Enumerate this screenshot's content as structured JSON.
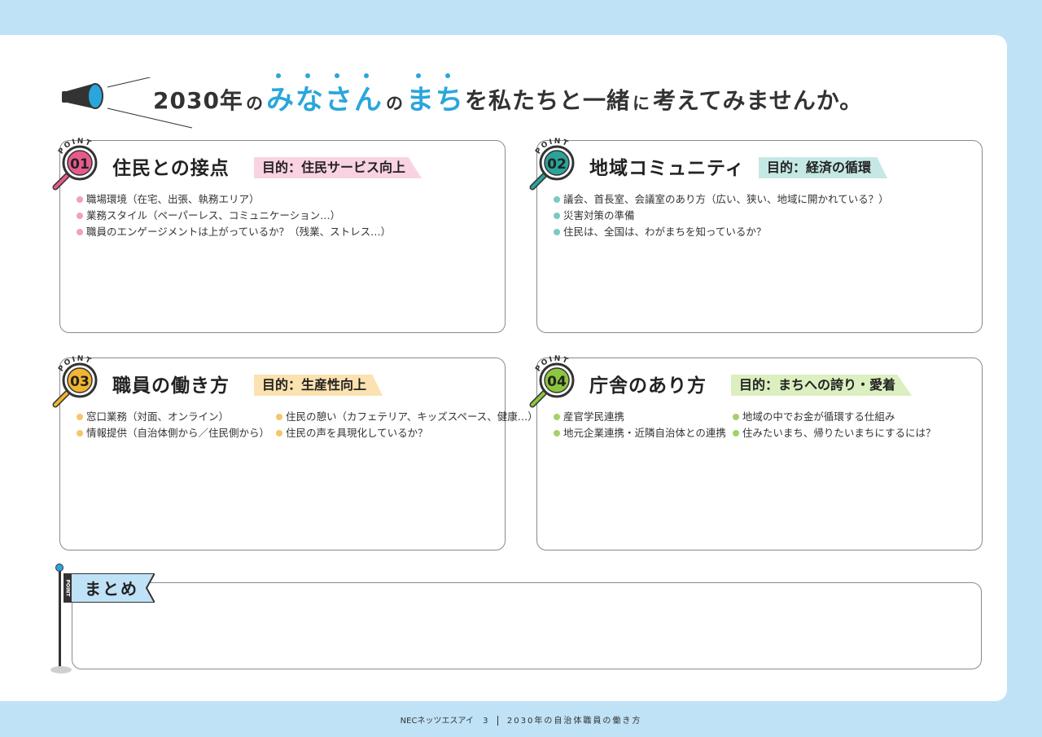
{
  "header": {
    "title_part1": "2030年",
    "title_part2": "の",
    "title_highlight1": "みなさん",
    "title_part3": "の",
    "title_highlight2": "まち",
    "title_part4": "を私たちと一緒",
    "title_part5": "に",
    "title_part6": "考えてみませんか。",
    "megaphone_icon": "megaphone-icon"
  },
  "points": [
    {
      "badge_label": "POINT",
      "number": "01",
      "title": "住民との接点",
      "goal": "目的：住民サービス向上",
      "color": "#e85a8e",
      "goal_bg": "#f9d3e2",
      "dot_color": "#f0a0c0",
      "items": [
        "職場環境（在宅、出張、執務エリア）",
        "業務スタイル（ペーパーレス、コミュニケーション…）",
        "職員のエンゲージメントは上がっているか？（残業、ストレス…）"
      ]
    },
    {
      "badge_label": "POINT",
      "number": "02",
      "title": "地域コミュニティ",
      "goal": "目的：経済の循環",
      "color": "#2aa39a",
      "goal_bg": "#c5e8e4",
      "dot_color": "#7cc9c0",
      "items": [
        "議会、首長室、会議室のあり方（広い、狭い、地域に開かれている？）",
        "災害対策の準備",
        "住民は、全国は、わがまちを知っているか？"
      ]
    },
    {
      "badge_label": "POINT",
      "number": "03",
      "title": "職員の働き方",
      "goal": "目的：生産性向上",
      "color": "#f2b531",
      "goal_bg": "#fbe2b0",
      "dot_color": "#f5c66a",
      "items_left": [
        "窓口業務（対面、オンライン）",
        "情報提供（自治体側から／住民側から）"
      ],
      "items_right": [
        "住民の憩い（カフェテリア、キッズスペース、健康…）",
        "住民の声を具現化しているか？"
      ]
    },
    {
      "badge_label": "POINT",
      "number": "04",
      "title": "庁舎のあり方",
      "goal": "目的：まちへの誇り・愛着",
      "color": "#8cc63f",
      "goal_bg": "#dcefc0",
      "dot_color": "#a6d16a",
      "items_left": [
        "産官学民連携",
        "地元企業連携・近隣自治体との連携"
      ],
      "items_right": [
        "地域の中でお金が循環する仕組み",
        "住みたいまち、帰りたいまちにするには？"
      ]
    }
  ],
  "summary": {
    "flag_side_label": "POINT",
    "label": "まとめ"
  },
  "footer": {
    "publisher": "NECネッツエスアイ",
    "page": "3",
    "doc_title": "2030年の自治体職員の働き方"
  }
}
